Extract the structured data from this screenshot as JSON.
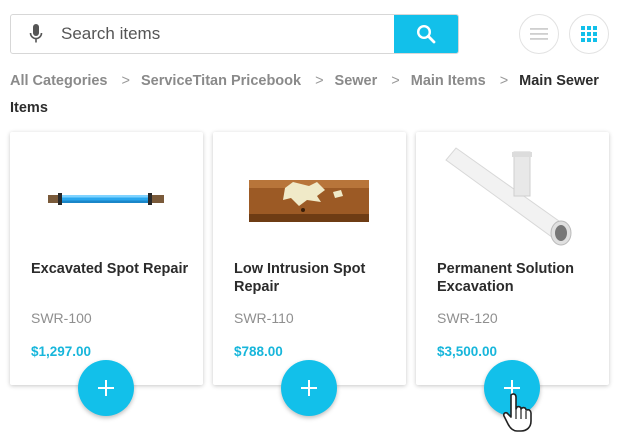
{
  "search": {
    "placeholder": "Search items",
    "value": "",
    "mic_icon": "microphone-icon",
    "button_icon": "search-icon"
  },
  "header_buttons": [
    {
      "icon": "hamburger-menu-icon"
    },
    {
      "icon": "grid-view-icon"
    }
  ],
  "breadcrumb": {
    "items": [
      "All Categories",
      "ServiceTitan Pricebook",
      "Sewer",
      "Main Items",
      "Main Sewer Items"
    ],
    "separator": ">"
  },
  "cards": [
    {
      "name": "Excavated Spot Repair",
      "code": "SWR-100",
      "price": "$1,297.00",
      "image": "blue-pipe-image",
      "add_icon": "plus-icon"
    },
    {
      "name": "Low Intrusion Spot Repair",
      "code": "SWR-110",
      "price": "$788.00",
      "image": "damaged-pipe-image",
      "add_icon": "plus-icon"
    },
    {
      "name": "Permanent Solution Excavation",
      "code": "SWR-120",
      "price": "$3,500.00",
      "image": "pvc-pipe-tee-image",
      "add_icon": "plus-icon"
    }
  ],
  "colors": {
    "accent": "#12c0ea",
    "price": "#17b6db",
    "muted": "#8a8a8a",
    "text": "#2b2b2b"
  }
}
